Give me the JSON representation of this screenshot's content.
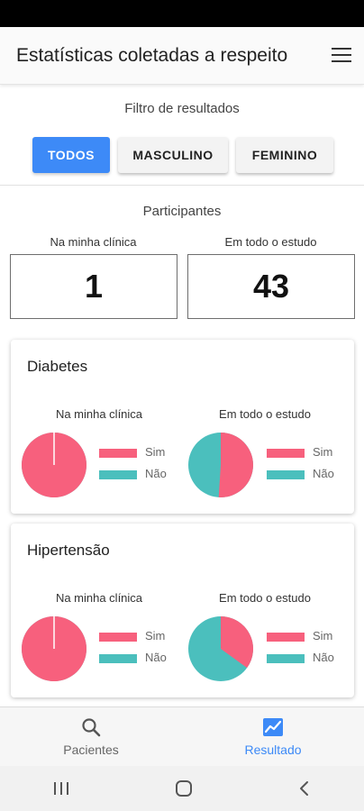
{
  "app_bar": {
    "title": "Estatísticas coletadas a respeito",
    "menu_icon": "hamburger-menu-icon"
  },
  "filter": {
    "title": "Filtro de resultados",
    "buttons": [
      {
        "label": "TODOS",
        "selected": true
      },
      {
        "label": "MASCULINO",
        "selected": false
      },
      {
        "label": "FEMININO",
        "selected": false
      }
    ],
    "accent_color": "#3d8af7"
  },
  "participants": {
    "title": "Participantes",
    "clinic_label": "Na minha clínica",
    "study_label": "Em todo o estudo",
    "clinic_count": "1",
    "study_count": "43"
  },
  "colors": {
    "sim": "#f7607d",
    "nao": "#4bbfbd"
  },
  "cards": [
    {
      "title": "Diabetes",
      "clinic_label": "Na minha clínica",
      "study_label": "Em todo o estudo",
      "legend_sim": "Sim",
      "legend_nao": "Não",
      "clinic_sim_fraction": 1.0,
      "study_sim_fraction": 0.51
    },
    {
      "title": "Hipertensão",
      "clinic_label": "Na minha clínica",
      "study_label": "Em todo o estudo",
      "legend_sim": "Sim",
      "legend_nao": "Não",
      "clinic_sim_fraction": 1.0,
      "study_sim_fraction": 0.35
    }
  ],
  "bottom_nav": {
    "items": [
      {
        "label": "Pacientes",
        "icon": "search-icon",
        "active": false
      },
      {
        "label": "Resultado",
        "icon": "chart-icon",
        "active": true
      }
    ]
  },
  "system_nav": {
    "icons": [
      "recent-apps-icon",
      "home-icon",
      "back-icon"
    ]
  }
}
